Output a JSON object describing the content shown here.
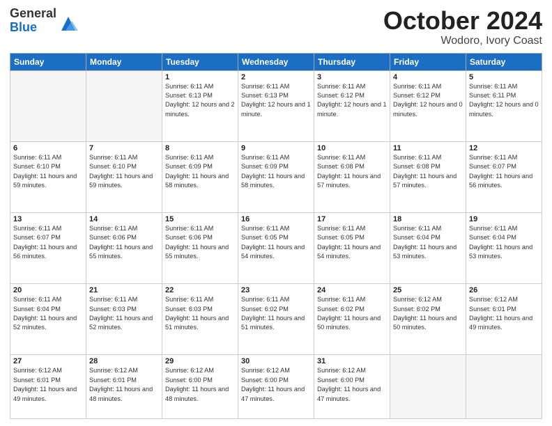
{
  "header": {
    "logo_general": "General",
    "logo_blue": "Blue",
    "month_title": "October 2024",
    "subtitle": "Wodoro, Ivory Coast"
  },
  "weekdays": [
    "Sunday",
    "Monday",
    "Tuesday",
    "Wednesday",
    "Thursday",
    "Friday",
    "Saturday"
  ],
  "weeks": [
    [
      {
        "day": "",
        "empty": true
      },
      {
        "day": "",
        "empty": true
      },
      {
        "day": "1",
        "sunrise": "6:11 AM",
        "sunset": "6:13 PM",
        "daylight": "12 hours and 2 minutes."
      },
      {
        "day": "2",
        "sunrise": "6:11 AM",
        "sunset": "6:13 PM",
        "daylight": "12 hours and 1 minute."
      },
      {
        "day": "3",
        "sunrise": "6:11 AM",
        "sunset": "6:12 PM",
        "daylight": "12 hours and 1 minute."
      },
      {
        "day": "4",
        "sunrise": "6:11 AM",
        "sunset": "6:12 PM",
        "daylight": "12 hours and 0 minutes."
      },
      {
        "day": "5",
        "sunrise": "6:11 AM",
        "sunset": "6:11 PM",
        "daylight": "12 hours and 0 minutes."
      }
    ],
    [
      {
        "day": "6",
        "sunrise": "6:11 AM",
        "sunset": "6:10 PM",
        "daylight": "11 hours and 59 minutes."
      },
      {
        "day": "7",
        "sunrise": "6:11 AM",
        "sunset": "6:10 PM",
        "daylight": "11 hours and 59 minutes."
      },
      {
        "day": "8",
        "sunrise": "6:11 AM",
        "sunset": "6:09 PM",
        "daylight": "11 hours and 58 minutes."
      },
      {
        "day": "9",
        "sunrise": "6:11 AM",
        "sunset": "6:09 PM",
        "daylight": "11 hours and 58 minutes."
      },
      {
        "day": "10",
        "sunrise": "6:11 AM",
        "sunset": "6:08 PM",
        "daylight": "11 hours and 57 minutes."
      },
      {
        "day": "11",
        "sunrise": "6:11 AM",
        "sunset": "6:08 PM",
        "daylight": "11 hours and 57 minutes."
      },
      {
        "day": "12",
        "sunrise": "6:11 AM",
        "sunset": "6:07 PM",
        "daylight": "11 hours and 56 minutes."
      }
    ],
    [
      {
        "day": "13",
        "sunrise": "6:11 AM",
        "sunset": "6:07 PM",
        "daylight": "11 hours and 56 minutes."
      },
      {
        "day": "14",
        "sunrise": "6:11 AM",
        "sunset": "6:06 PM",
        "daylight": "11 hours and 55 minutes."
      },
      {
        "day": "15",
        "sunrise": "6:11 AM",
        "sunset": "6:06 PM",
        "daylight": "11 hours and 55 minutes."
      },
      {
        "day": "16",
        "sunrise": "6:11 AM",
        "sunset": "6:05 PM",
        "daylight": "11 hours and 54 minutes."
      },
      {
        "day": "17",
        "sunrise": "6:11 AM",
        "sunset": "6:05 PM",
        "daylight": "11 hours and 54 minutes."
      },
      {
        "day": "18",
        "sunrise": "6:11 AM",
        "sunset": "6:04 PM",
        "daylight": "11 hours and 53 minutes."
      },
      {
        "day": "19",
        "sunrise": "6:11 AM",
        "sunset": "6:04 PM",
        "daylight": "11 hours and 53 minutes."
      }
    ],
    [
      {
        "day": "20",
        "sunrise": "6:11 AM",
        "sunset": "6:04 PM",
        "daylight": "11 hours and 52 minutes."
      },
      {
        "day": "21",
        "sunrise": "6:11 AM",
        "sunset": "6:03 PM",
        "daylight": "11 hours and 52 minutes."
      },
      {
        "day": "22",
        "sunrise": "6:11 AM",
        "sunset": "6:03 PM",
        "daylight": "11 hours and 51 minutes."
      },
      {
        "day": "23",
        "sunrise": "6:11 AM",
        "sunset": "6:02 PM",
        "daylight": "11 hours and 51 minutes."
      },
      {
        "day": "24",
        "sunrise": "6:11 AM",
        "sunset": "6:02 PM",
        "daylight": "11 hours and 50 minutes."
      },
      {
        "day": "25",
        "sunrise": "6:12 AM",
        "sunset": "6:02 PM",
        "daylight": "11 hours and 50 minutes."
      },
      {
        "day": "26",
        "sunrise": "6:12 AM",
        "sunset": "6:01 PM",
        "daylight": "11 hours and 49 minutes."
      }
    ],
    [
      {
        "day": "27",
        "sunrise": "6:12 AM",
        "sunset": "6:01 PM",
        "daylight": "11 hours and 49 minutes."
      },
      {
        "day": "28",
        "sunrise": "6:12 AM",
        "sunset": "6:01 PM",
        "daylight": "11 hours and 48 minutes."
      },
      {
        "day": "29",
        "sunrise": "6:12 AM",
        "sunset": "6:00 PM",
        "daylight": "11 hours and 48 minutes."
      },
      {
        "day": "30",
        "sunrise": "6:12 AM",
        "sunset": "6:00 PM",
        "daylight": "11 hours and 47 minutes."
      },
      {
        "day": "31",
        "sunrise": "6:12 AM",
        "sunset": "6:00 PM",
        "daylight": "11 hours and 47 minutes."
      },
      {
        "day": "",
        "empty": true
      },
      {
        "day": "",
        "empty": true
      }
    ]
  ]
}
